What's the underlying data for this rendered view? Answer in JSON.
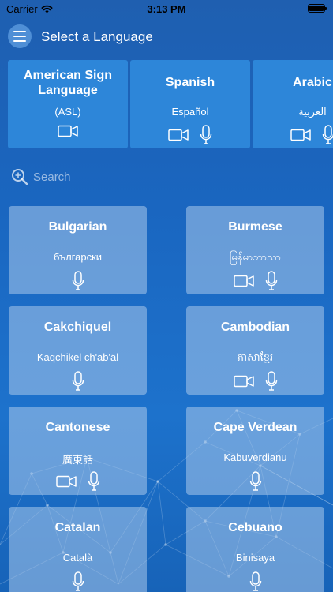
{
  "status_bar": {
    "carrier": "Carrier",
    "time": "3:13 PM"
  },
  "header": {
    "title": "Select a Language"
  },
  "featured": [
    {
      "name": "American Sign Language",
      "native": "(ASL)",
      "video": true,
      "audio": false
    },
    {
      "name": "Spanish",
      "native": "Español",
      "video": true,
      "audio": true
    },
    {
      "name": "Arabic",
      "native": "العربية",
      "video": true,
      "audio": true
    }
  ],
  "search": {
    "placeholder": "Search"
  },
  "languages": [
    {
      "name": "Bulgarian",
      "native": "български",
      "video": false,
      "audio": true
    },
    {
      "name": "Burmese",
      "native": "မြန်မာဘာသာ",
      "video": true,
      "audio": true
    },
    {
      "name": "Cakchiquel",
      "native": "Kaqchikel ch'ab'äl",
      "video": false,
      "audio": true
    },
    {
      "name": "Cambodian",
      "native": "ភាសាខ្មែរ",
      "video": true,
      "audio": true
    },
    {
      "name": "Cantonese",
      "native": "廣東話",
      "video": true,
      "audio": true
    },
    {
      "name": "Cape Verdean",
      "native": "Kabuverdianu",
      "video": false,
      "audio": true
    },
    {
      "name": "Catalan",
      "native": "Català",
      "video": false,
      "audio": true
    },
    {
      "name": "Cebuano",
      "native": "Binisaya",
      "video": false,
      "audio": true
    }
  ],
  "colors": {
    "background": "#1a66c0",
    "featured_card": "#2d86d9",
    "grid_card": "#aac8eb"
  }
}
